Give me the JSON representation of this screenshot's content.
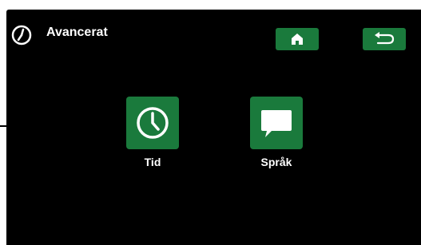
{
  "header": {
    "title": "Avancerat",
    "icon": "clock-icon"
  },
  "nav": {
    "home_icon": "home-icon",
    "back_icon": "back-arrow-icon"
  },
  "tiles": [
    {
      "label": "Tid",
      "icon": "clock-icon"
    },
    {
      "label": "Språk",
      "icon": "speech-bubble-icon"
    }
  ],
  "colors": {
    "background": "#000000",
    "accent": "#1a7a3c",
    "text": "#ffffff"
  }
}
